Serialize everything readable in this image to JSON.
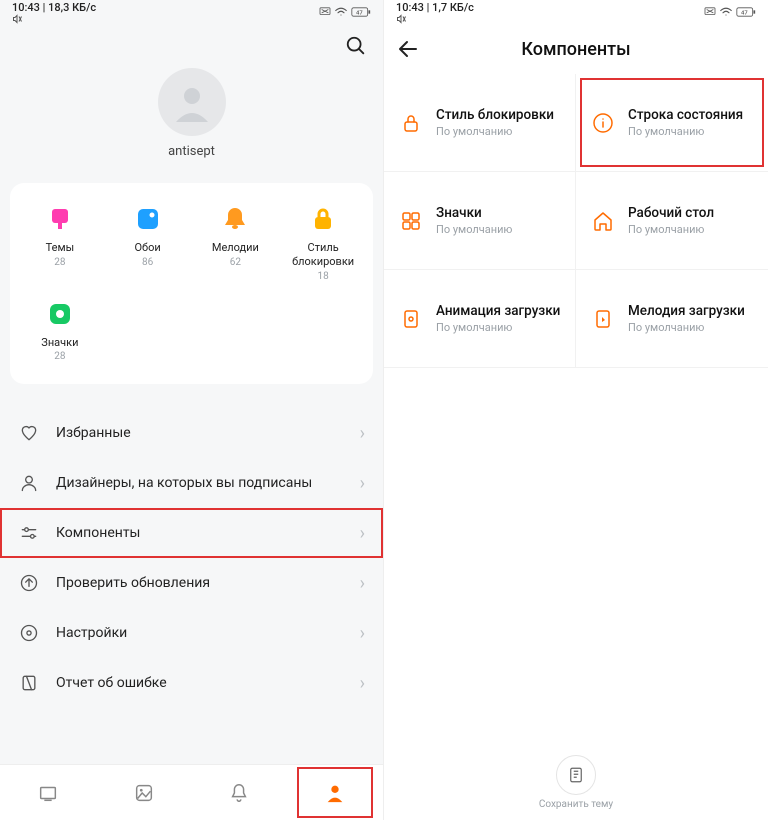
{
  "left": {
    "status": {
      "time": "10:43",
      "net": "18,3 КБ/с",
      "mute": true
    },
    "profile": {
      "username": "antisept"
    },
    "tiles": [
      {
        "label": "Темы",
        "count": "28",
        "icon": "themes",
        "color": "#ff3cb0"
      },
      {
        "label": "Обои",
        "count": "86",
        "icon": "wallpapers",
        "color": "#1ea0ff"
      },
      {
        "label": "Мелодии",
        "count": "62",
        "icon": "ringtones",
        "color": "#ff9a1f"
      },
      {
        "label": "Стиль блокировки",
        "count": "18",
        "icon": "lockstyle",
        "color": "#ffb300"
      },
      {
        "label": "Значки",
        "count": "28",
        "icon": "icons",
        "color": "#17c964"
      }
    ],
    "menu": [
      {
        "label": "Избранные",
        "icon": "heart"
      },
      {
        "label": "Дизайнеры, на которых вы подписаны",
        "icon": "person"
      },
      {
        "label": "Компоненты",
        "icon": "sliders",
        "highlighted": true
      },
      {
        "label": "Проверить обновления",
        "icon": "upload"
      },
      {
        "label": "Настройки",
        "icon": "gear"
      },
      {
        "label": "Отчет об ошибке",
        "icon": "report"
      }
    ],
    "nav": [
      {
        "name": "home",
        "active": false
      },
      {
        "name": "wallpapers",
        "active": false
      },
      {
        "name": "ringtones",
        "active": false
      },
      {
        "name": "profile",
        "active": true,
        "highlighted": true
      }
    ]
  },
  "right": {
    "status": {
      "time": "10:43",
      "net": "1,7 КБ/с",
      "mute": true
    },
    "title": "Компоненты",
    "default_text": "По умолчанию",
    "components": [
      {
        "title": "Стиль блокировки",
        "sub": "По умолчанию",
        "icon": "lock"
      },
      {
        "title": "Строка состояния",
        "sub": "По умолчанию",
        "icon": "info",
        "highlighted": true
      },
      {
        "title": "Значки",
        "sub": "По умолчанию",
        "icon": "grid"
      },
      {
        "title": "Рабочий стол",
        "sub": "По умолчанию",
        "icon": "home"
      },
      {
        "title": "Анимация загрузки",
        "sub": "По умолчанию",
        "icon": "boot-anim"
      },
      {
        "title": "Мелодия загрузки",
        "sub": "По умолчанию",
        "icon": "boot-sound"
      }
    ],
    "bottom_action": "Сохранить тему"
  }
}
